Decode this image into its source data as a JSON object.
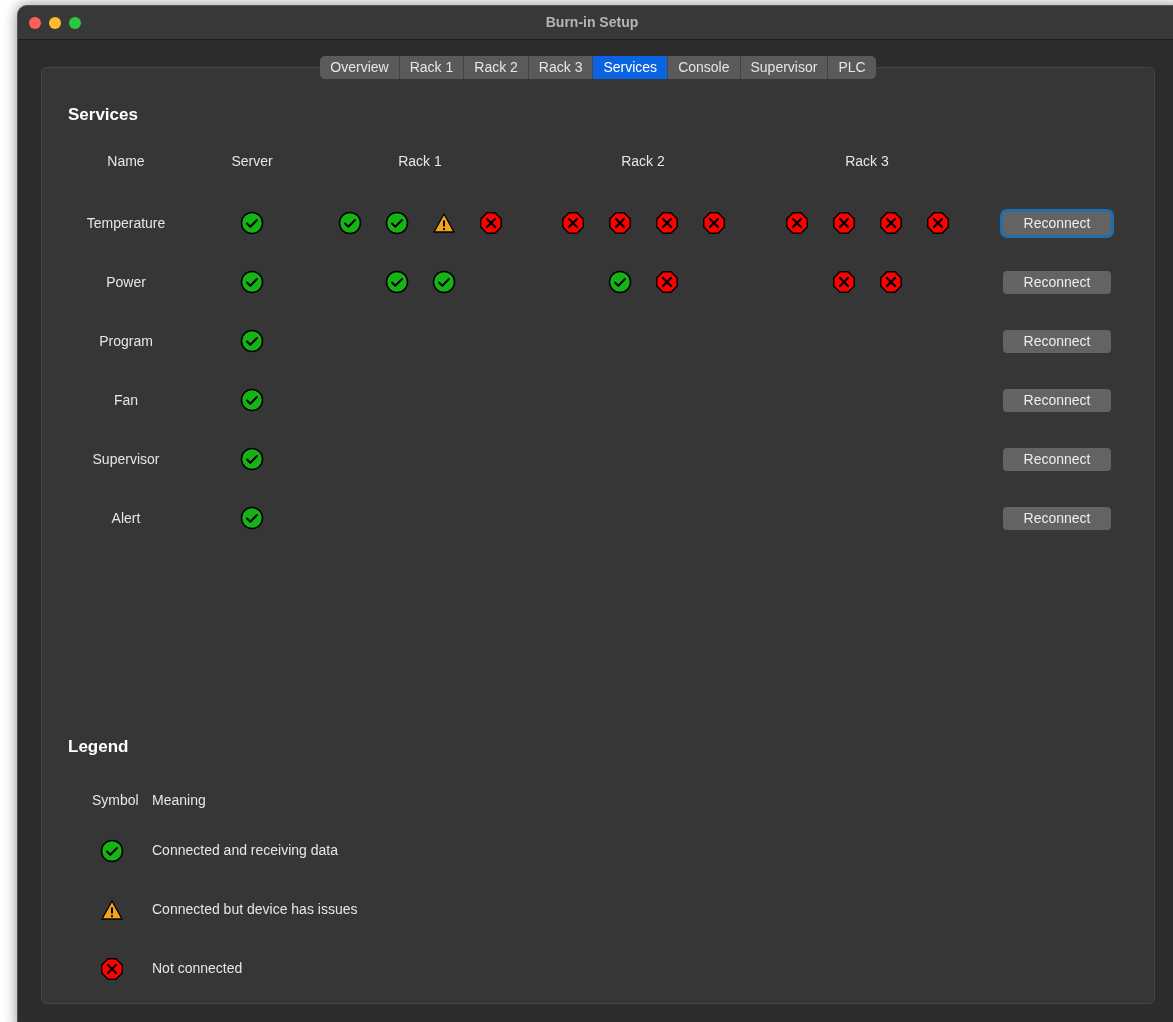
{
  "window": {
    "title": "Burn-in Setup"
  },
  "tabs": [
    {
      "label": "Overview",
      "selected": false
    },
    {
      "label": "Rack 1",
      "selected": false
    },
    {
      "label": "Rack 2",
      "selected": false
    },
    {
      "label": "Rack 3",
      "selected": false
    },
    {
      "label": "Services",
      "selected": true
    },
    {
      "label": "Console",
      "selected": false
    },
    {
      "label": "Supervisor",
      "selected": false
    },
    {
      "label": "PLC",
      "selected": false
    }
  ],
  "services": {
    "title": "Services",
    "columns": {
      "name": "Name",
      "server": "Server",
      "racks": [
        "Rack 1",
        "Rack 2",
        "Rack 3"
      ]
    },
    "rows": [
      {
        "name": "Temperature",
        "server": {
          "kind": "ok"
        },
        "racks": [
          {
            "slots": [
              {
                "kind": "ok"
              },
              {
                "kind": "ok"
              },
              {
                "kind": "warn"
              },
              {
                "kind": "error"
              }
            ]
          },
          {
            "slots": [
              {
                "kind": "error"
              },
              {
                "kind": "error"
              },
              {
                "kind": "error"
              },
              {
                "kind": "error"
              }
            ]
          },
          {
            "slots": [
              {
                "kind": "error"
              },
              {
                "kind": "error"
              },
              {
                "kind": "error"
              },
              {
                "kind": "error"
              }
            ]
          }
        ],
        "button": {
          "label": "Reconnect",
          "focused": true
        }
      },
      {
        "name": "Power",
        "server": {
          "kind": "ok"
        },
        "racks": [
          {
            "slots": [
              {
                "kind": "empty"
              },
              {
                "kind": "ok"
              },
              {
                "kind": "ok"
              },
              {
                "kind": "empty"
              }
            ]
          },
          {
            "slots": [
              {
                "kind": "empty"
              },
              {
                "kind": "ok"
              },
              {
                "kind": "error"
              },
              {
                "kind": "empty"
              }
            ]
          },
          {
            "slots": [
              {
                "kind": "empty"
              },
              {
                "kind": "error"
              },
              {
                "kind": "error"
              },
              {
                "kind": "empty"
              }
            ]
          }
        ],
        "button": {
          "label": "Reconnect",
          "focused": false
        }
      },
      {
        "name": "Program",
        "server": {
          "kind": "ok"
        },
        "button": {
          "label": "Reconnect",
          "focused": false
        }
      },
      {
        "name": "Fan",
        "server": {
          "kind": "ok"
        },
        "button": {
          "label": "Reconnect",
          "focused": false
        }
      },
      {
        "name": "Supervisor",
        "server": {
          "kind": "ok"
        },
        "button": {
          "label": "Reconnect",
          "focused": false
        }
      },
      {
        "name": "Alert",
        "server": {
          "kind": "ok"
        },
        "button": {
          "label": "Reconnect",
          "focused": false
        }
      }
    ]
  },
  "legend": {
    "title": "Legend",
    "columns": [
      "Symbol",
      "Meaning"
    ],
    "items": [
      {
        "kind": "ok",
        "meaning": "Connected and receiving data"
      },
      {
        "kind": "warn",
        "meaning": "Connected but device has issues"
      },
      {
        "kind": "error",
        "meaning": "Not connected"
      }
    ]
  }
}
